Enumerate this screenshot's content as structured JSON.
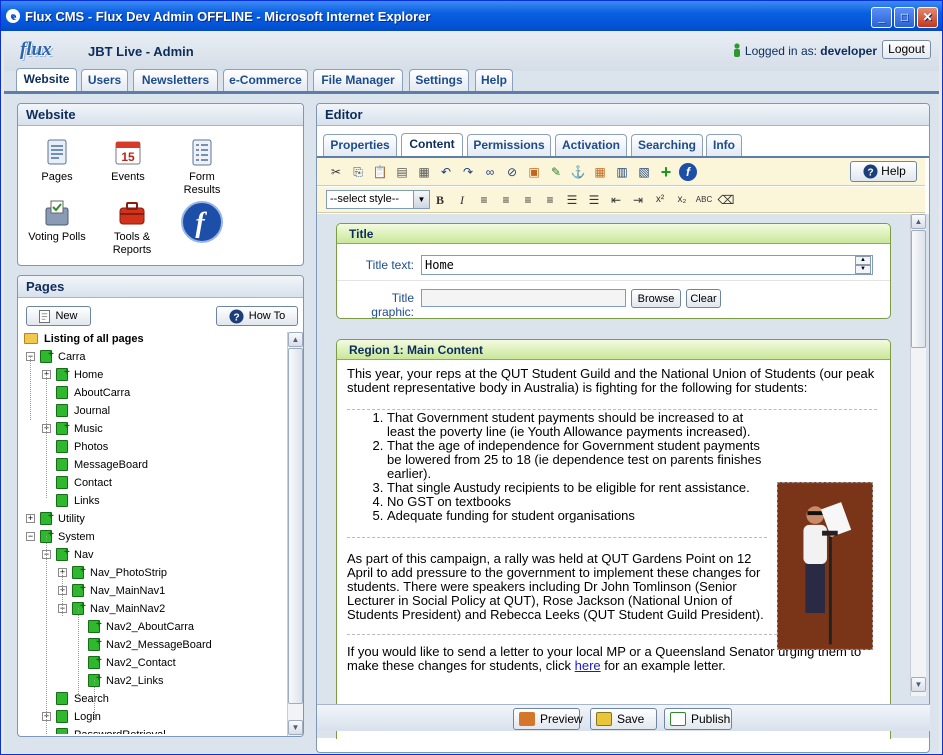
{
  "window": {
    "title": "Flux CMS - Flux Dev Admin OFFLINE - Microsoft Internet Explorer",
    "minimize": "_",
    "maximize": "□",
    "close": "✕"
  },
  "header": {
    "logo": "flux",
    "site_name": "JBT Live - Admin",
    "logged_in_prefix": "Logged in as:",
    "username": "developer",
    "logout": "Logout"
  },
  "main_tabs": [
    "Website",
    "Users",
    "Newsletters",
    "e-Commerce",
    "File Manager",
    "Settings",
    "Help"
  ],
  "website_panel": {
    "title": "Website",
    "items": [
      {
        "label": "Pages",
        "icon": "pages-icon"
      },
      {
        "label": "Events",
        "icon": "calendar-icon",
        "day": "15"
      },
      {
        "label": "Form Results",
        "icon": "form-icon"
      },
      {
        "label": "Voting Polls",
        "icon": "poll-icon"
      },
      {
        "label": "Tools & Reports",
        "icon": "toolbox-icon"
      },
      {
        "label": "",
        "icon": "flux-logo-icon",
        "glyph": "f"
      }
    ]
  },
  "pages_panel": {
    "title": "Pages",
    "new_button": "New",
    "howto_button": "How To",
    "tree": [
      {
        "label": "Listing of all pages",
        "depth": 0,
        "toggle": "",
        "kind": "folder"
      },
      {
        "label": "Carra",
        "depth": 0,
        "toggle": "-",
        "kind": "pageplus"
      },
      {
        "label": "Home",
        "depth": 1,
        "toggle": "+",
        "kind": "pageplus"
      },
      {
        "label": "AboutCarra",
        "depth": 1,
        "toggle": "",
        "kind": "page"
      },
      {
        "label": "Journal",
        "depth": 1,
        "toggle": "",
        "kind": "page"
      },
      {
        "label": "Music",
        "depth": 1,
        "toggle": "+",
        "kind": "pageplus"
      },
      {
        "label": "Photos",
        "depth": 1,
        "toggle": "",
        "kind": "page"
      },
      {
        "label": "MessageBoard",
        "depth": 1,
        "toggle": "",
        "kind": "page"
      },
      {
        "label": "Contact",
        "depth": 1,
        "toggle": "",
        "kind": "page"
      },
      {
        "label": "Links",
        "depth": 1,
        "toggle": "",
        "kind": "page"
      },
      {
        "label": "Utility",
        "depth": 0,
        "toggle": "+",
        "kind": "pageplus"
      },
      {
        "label": "System",
        "depth": 0,
        "toggle": "-",
        "kind": "pageplus"
      },
      {
        "label": "Nav",
        "depth": 1,
        "toggle": "-",
        "kind": "pageplus"
      },
      {
        "label": "Nav_PhotoStrip",
        "depth": 2,
        "toggle": "+",
        "kind": "pageplus"
      },
      {
        "label": "Nav_MainNav1",
        "depth": 2,
        "toggle": "+",
        "kind": "pageplus"
      },
      {
        "label": "Nav_MainNav2",
        "depth": 2,
        "toggle": "-",
        "kind": "pageplus"
      },
      {
        "label": "Nav2_AboutCarra",
        "depth": 3,
        "toggle": "",
        "kind": "pageplus"
      },
      {
        "label": "Nav2_MessageBoard",
        "depth": 3,
        "toggle": "",
        "kind": "pageplus"
      },
      {
        "label": "Nav2_Contact",
        "depth": 3,
        "toggle": "",
        "kind": "pageplus"
      },
      {
        "label": "Nav2_Links",
        "depth": 3,
        "toggle": "",
        "kind": "pageplus"
      },
      {
        "label": "Search",
        "depth": 1,
        "toggle": "",
        "kind": "page"
      },
      {
        "label": "Login",
        "depth": 1,
        "toggle": "+",
        "kind": "page"
      },
      {
        "label": "PasswordRetrieval",
        "depth": 1,
        "toggle": "",
        "kind": "page"
      }
    ]
  },
  "editor": {
    "title": "Editor",
    "tabs": [
      "Properties",
      "Content",
      "Permissions",
      "Activation",
      "Searching",
      "Info"
    ],
    "help_button": "Help",
    "style_select": "--select style--",
    "toolbar_icons": [
      "cut-icon",
      "copy-icon",
      "paste-icon",
      "paste-text-icon",
      "paste-word-icon",
      "undo-icon",
      "redo-icon",
      "link-icon",
      "unlink-icon",
      "image-icon",
      "image-edit-icon",
      "anchor-icon",
      "table-icon",
      "table-edit-icon",
      "table-props-icon",
      "add-icon",
      "flux-icon"
    ],
    "format_icons": [
      "bold-icon",
      "italic-icon",
      "align-left-icon",
      "align-center-icon",
      "align-right-icon",
      "justify-icon",
      "bullet-list-icon",
      "numbered-list-icon",
      "outdent-icon",
      "indent-icon",
      "superscript-icon",
      "subscript-icon",
      "spellcheck-icon",
      "eraser-icon"
    ],
    "format_glyphs": [
      "B",
      "I",
      "≡",
      "≡",
      "≡",
      "≡",
      "☰",
      "☰",
      "⇤",
      "⇥",
      "x²",
      "x₂",
      "ABC",
      "⌫"
    ],
    "title_box": {
      "heading": "Title",
      "title_text_label": "Title text:",
      "title_text_value": "Home",
      "title_graphic_label": "Title graphic:",
      "browse": "Browse",
      "clear": "Clear"
    },
    "region_box": {
      "heading": "Region 1:  Main Content",
      "intro": "This year, your reps at the QUT Student Guild and the National Union of Students (our peak student representative body in Australia) is fighting for the following for students:",
      "list": [
        "That Government student payments should be increased to at least the poverty line (ie Youth Allowance payments increased).",
        "That the age of independence for Government student payments be lowered from 25 to 18 (ie dependence test on parents finishes earlier).",
        "That single Austudy recipients to be eligible for rent assistance.",
        "No GST on textbooks",
        "Adequate funding for student organisations"
      ],
      "para2": "As part of this campaign, a rally was held at QUT Gardens Point on 12 April to add pressure to the government to implement these changes for students. There were speakers including Dr John Tomlinson (Senior Lecturer in Social Policy at QUT), Rose Jackson (National Union of Students President) and Rebecca Leeks (QUT Student Guild President).",
      "para3_before": "If you would like to send a letter to your local MP or a Queensland Senator urging them to make these changes for students, click ",
      "para3_link": "here",
      "para3_after": " for an example letter."
    },
    "footer": {
      "preview": "Preview",
      "save": "Save",
      "publish": "Publish"
    }
  },
  "colors": {
    "title_bar": "#0454d8",
    "accent": "#1c4c8c",
    "region_header": "#c9e79a",
    "toolbar_bg": "#fbf6d9"
  }
}
